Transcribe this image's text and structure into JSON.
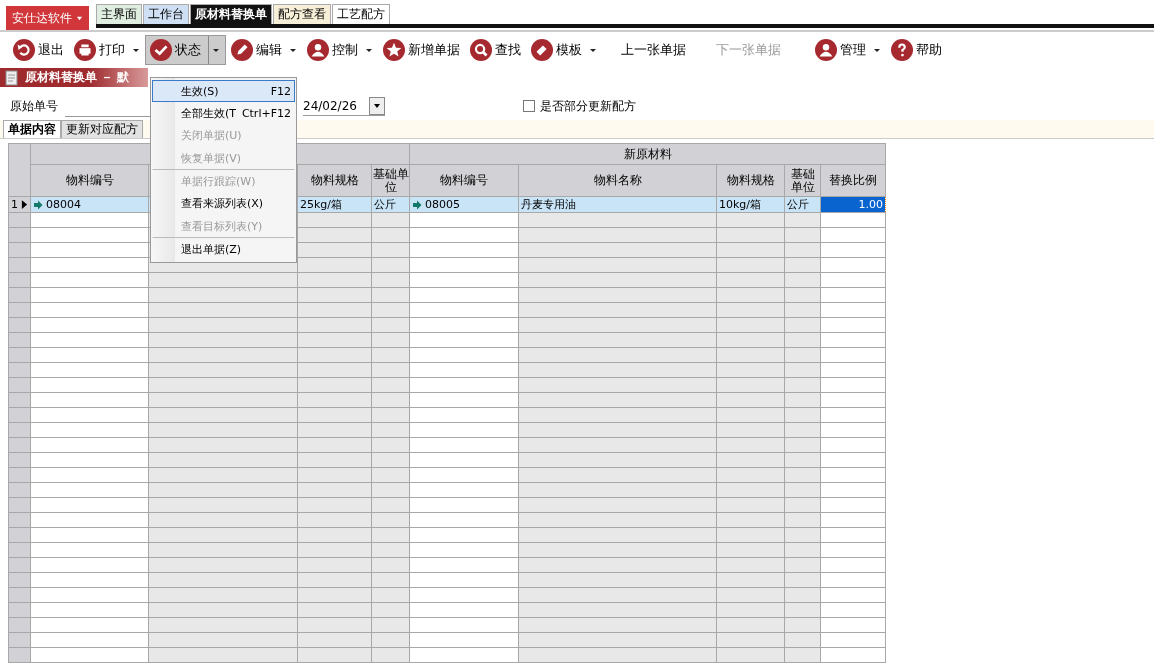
{
  "brand": {
    "label": "安仕达软件"
  },
  "tabs": [
    {
      "label": "主界面",
      "selected": false,
      "color": "#dfeee0"
    },
    {
      "label": "工作台",
      "selected": false,
      "color": "#cfe0f5"
    },
    {
      "label": "原材料替换单",
      "selected": true,
      "color": "#111111"
    },
    {
      "label": "配方查看",
      "selected": false,
      "color": "#f8efd8"
    },
    {
      "label": "工艺配方",
      "selected": false,
      "color": "#ffffff"
    }
  ],
  "toolbar": [
    {
      "label": "退出",
      "dropdown": false,
      "disabled": false,
      "pressed": false
    },
    {
      "label": "打印",
      "dropdown": true,
      "disabled": false,
      "pressed": false
    },
    {
      "label": "状态",
      "dropdown": true,
      "disabled": false,
      "pressed": true
    },
    {
      "label": "编辑",
      "dropdown": true,
      "disabled": false,
      "pressed": false
    },
    {
      "label": "控制",
      "dropdown": true,
      "disabled": false,
      "pressed": false
    },
    {
      "label": "新增单据",
      "dropdown": false,
      "disabled": false,
      "pressed": false
    },
    {
      "label": "查找",
      "dropdown": false,
      "disabled": false,
      "pressed": false
    },
    {
      "label": "模板",
      "dropdown": true,
      "disabled": false,
      "pressed": false
    },
    {
      "label": "上一张单据",
      "dropdown": false,
      "disabled": false,
      "pressed": false
    },
    {
      "label": "下一张单据",
      "dropdown": false,
      "disabled": true,
      "pressed": false
    },
    {
      "label": "管理",
      "dropdown": true,
      "disabled": false,
      "pressed": false
    },
    {
      "label": "帮助",
      "dropdown": false,
      "disabled": false,
      "pressed": false
    }
  ],
  "doc_title": "原材料替换单 － 默",
  "form": {
    "source_label": "原始单号",
    "date_value": "24/02/26",
    "partial_update": {
      "label": "是否部分更新配方",
      "checked": false
    }
  },
  "subtabs": [
    {
      "label": "单据内容",
      "selected": true
    },
    {
      "label": "更新对应配方",
      "selected": false
    }
  ],
  "table": {
    "new_group_header": "新原材料",
    "columns": [
      {
        "header": "物料编号"
      },
      {},
      {
        "header": "物料规格"
      },
      {
        "header": "基础单位"
      },
      {
        "header": "物料编号"
      },
      {
        "header": "物料名称"
      },
      {
        "header": "物料规格"
      },
      {
        "header": "基础单位"
      },
      {
        "header": "替换比例"
      }
    ],
    "rows": [
      {
        "number": "1",
        "current": true,
        "cells": [
          "08004",
          "",
          "25kg/箱",
          "公斤",
          "08005",
          "丹麦专用油",
          "10kg/箱",
          "公斤",
          "1.00"
        ]
      }
    ]
  },
  "menu": [
    {
      "label": "生效(S)",
      "shortcut": "F12",
      "disabled": false,
      "selected": true,
      "separator_after": false
    },
    {
      "label": "全部生效(T",
      "shortcut": "Ctrl+F12",
      "disabled": false,
      "selected": false,
      "separator_after": false
    },
    {
      "label": "关闭单据(U)",
      "disabled": true,
      "selected": false,
      "separator_after": false
    },
    {
      "label": "恢复单据(V)",
      "disabled": true,
      "selected": false,
      "separator_after": true
    },
    {
      "label": "单据行跟踪(W)",
      "disabled": true,
      "selected": false,
      "separator_after": false
    },
    {
      "label": "查看来源列表(X)",
      "disabled": false,
      "selected": false,
      "separator_after": false
    },
    {
      "label": "查看目标列表(Y)",
      "disabled": true,
      "selected": false,
      "separator_after": true
    },
    {
      "label": "退出单据(Z)",
      "disabled": false,
      "selected": false,
      "separator_after": false
    }
  ]
}
